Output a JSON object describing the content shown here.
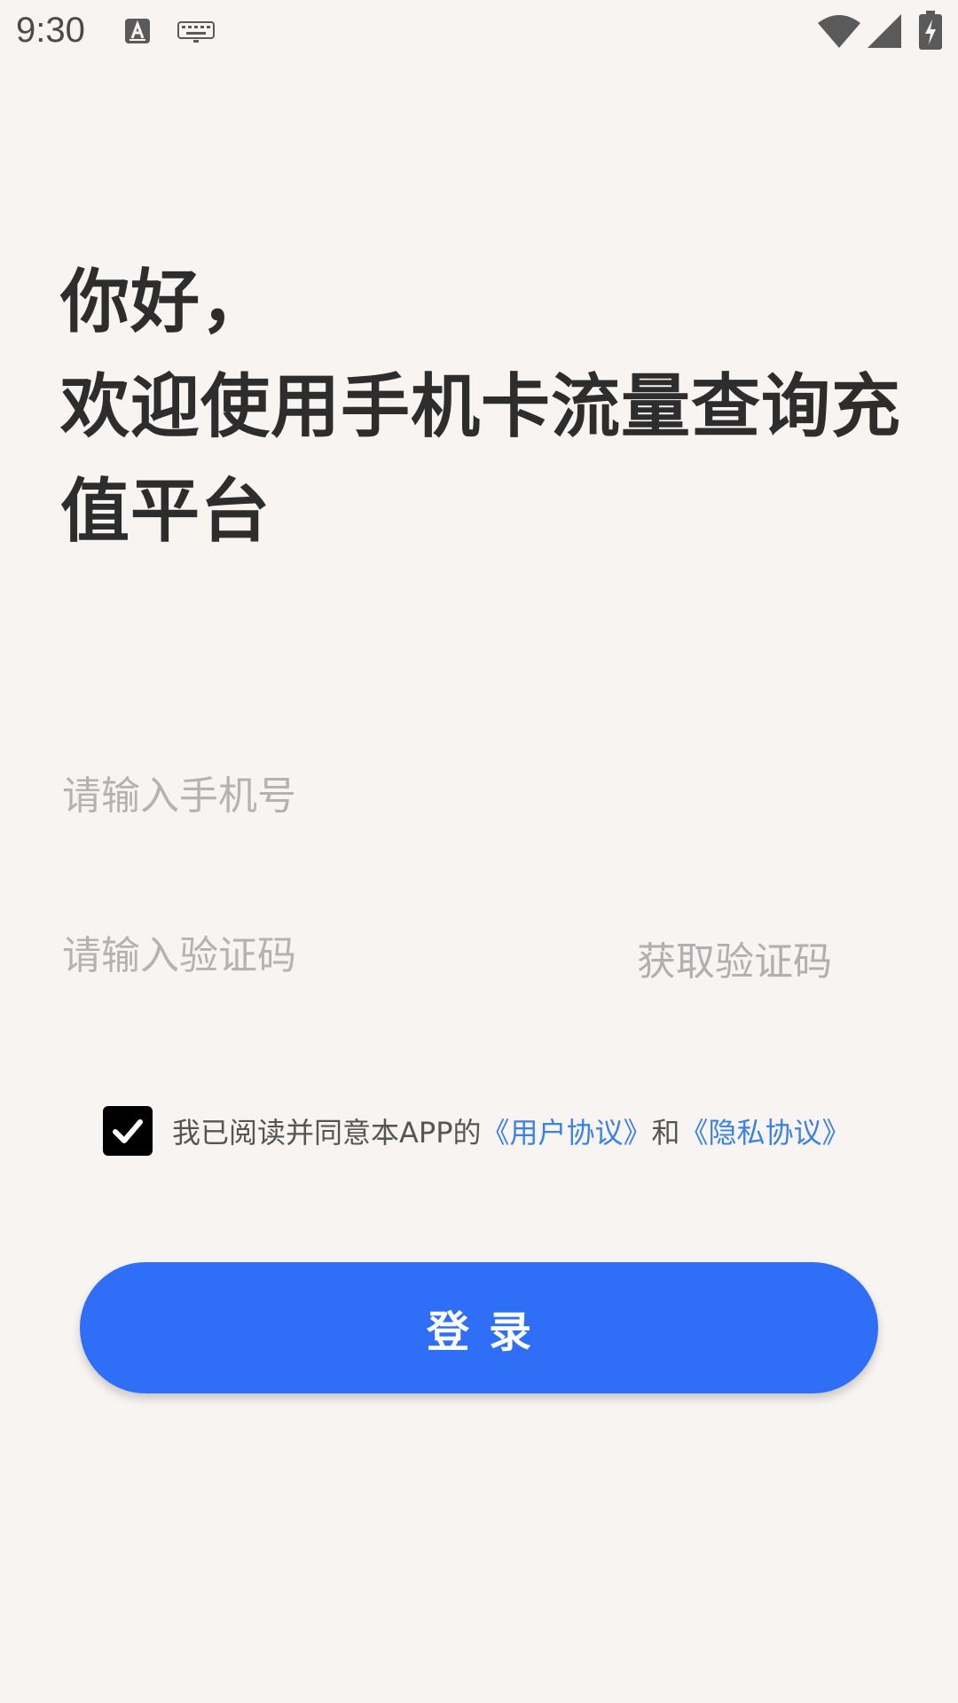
{
  "status_bar": {
    "time": "9:30",
    "icons": [
      "text-a-icon",
      "keyboard-icon",
      "wifi-icon",
      "signal-icon",
      "battery-charging-icon"
    ]
  },
  "greeting": {
    "line1": "你好，",
    "line2": "欢迎使用手机卡流量查询充值平台"
  },
  "form": {
    "phone_placeholder": "请输入手机号",
    "code_placeholder": "请输入验证码",
    "get_code_label": "获取验证码"
  },
  "agreement": {
    "checked": true,
    "prefix": "我已阅读并同意本APP的",
    "user_agreement": "《用户协议》",
    "conjunction": "和",
    "privacy_policy": "《隐私协议》"
  },
  "login": {
    "label": "登录"
  },
  "colors": {
    "background": "#f7f4f2",
    "primary": "#2f6ff8",
    "link": "#3b82e6",
    "placeholder": "#b3b3b3"
  }
}
